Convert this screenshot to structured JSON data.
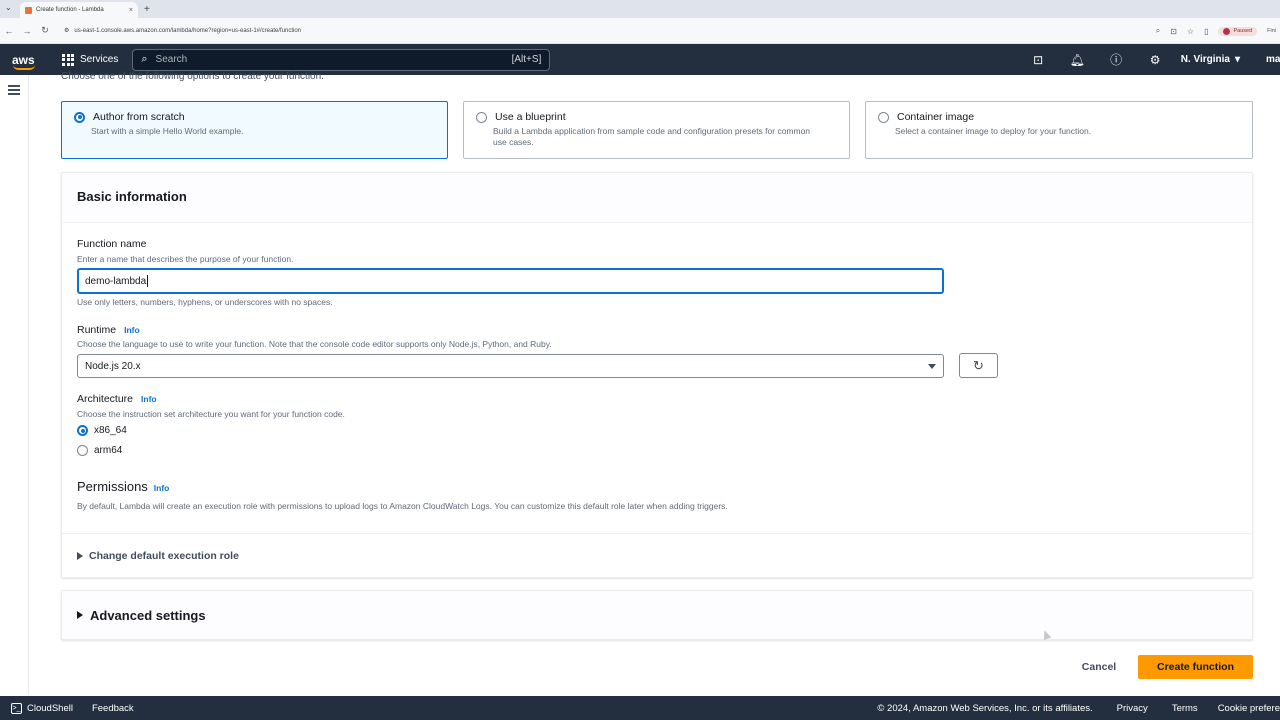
{
  "browser": {
    "tab_title": "Create function - Lambda",
    "tab_close": "×",
    "new_tab": "+",
    "url": "us-east-1.console.aws.amazon.com/lambda/home?region=us-east-1#/create/function",
    "paused_label": "Paused",
    "extra_label": "Fini"
  },
  "aws_nav": {
    "logo": "aws",
    "services_label": "Services",
    "search_placeholder": "Search",
    "search_shortcut": "[Alt+S]",
    "region_label": "N. Virginia",
    "account_label": "ma"
  },
  "content": {
    "intro_text": "Choose one of the following options to create your function.",
    "options": [
      {
        "title": "Author from scratch",
        "desc": "Start with a simple Hello World example.",
        "selected": true
      },
      {
        "title": "Use a blueprint",
        "desc": "Build a Lambda application from sample code and configuration presets for common use cases.",
        "selected": false
      },
      {
        "title": "Container image",
        "desc": "Select a container image to deploy for your function.",
        "selected": false
      }
    ],
    "basic_info": {
      "heading": "Basic information",
      "function_name_label": "Function name",
      "function_name_desc": "Enter a name that describes the purpose of your function.",
      "function_name_value": "demo-lambda",
      "function_name_hint": "Use only letters, numbers, hyphens, or underscores with no spaces.",
      "runtime_label": "Runtime",
      "runtime_info": "Info",
      "runtime_desc": "Choose the language to use to write your function. Note that the console code editor supports only Node.js, Python, and Ruby.",
      "runtime_value": "Node.js 20.x",
      "architecture_label": "Architecture",
      "architecture_info": "Info",
      "architecture_desc": "Choose the instruction set architecture you want for your function code.",
      "architecture_options": [
        {
          "label": "x86_64",
          "selected": true
        },
        {
          "label": "arm64",
          "selected": false
        }
      ],
      "permissions_label": "Permissions",
      "permissions_info": "Info",
      "permissions_desc": "By default, Lambda will create an execution role with permissions to upload logs to Amazon CloudWatch Logs. You can customize this default role later when adding triggers.",
      "change_role_label": "Change default execution role"
    },
    "advanced_label": "Advanced settings",
    "cancel_label": "Cancel",
    "create_label": "Create function"
  },
  "footer": {
    "cloudshell": "CloudShell",
    "feedback": "Feedback",
    "copyright": "© 2024, Amazon Web Services, Inc. or its affiliates.",
    "privacy": "Privacy",
    "terms": "Terms",
    "cookie": "Cookie prefere"
  }
}
